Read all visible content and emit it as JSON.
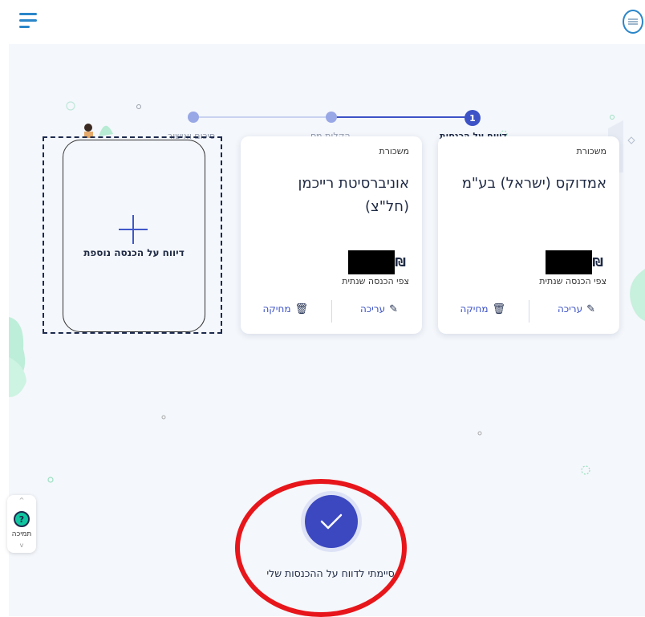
{
  "header": {
    "menu_icon": "hamburger-menu-icon",
    "logo_icon": "organization-logo-icon"
  },
  "stepper": {
    "steps": [
      {
        "label": "דיווח על הכנסות",
        "number": "1",
        "state": "current"
      },
      {
        "label": "הקלות מס",
        "number": "",
        "state": "upcoming"
      },
      {
        "label": "סיכום ואישור",
        "number": "",
        "state": "upcoming"
      }
    ]
  },
  "add_card": {
    "label": "דיווח על הכנסה נוספת",
    "icon": "plus-icon"
  },
  "income_cards": [
    {
      "type": "משכורת",
      "title": "אמדוקס (ישראל) בע\"מ",
      "currency": "₪",
      "amount_redacted": true,
      "amount_subtitle": "צפי הכנסה שנתית",
      "edit_label": "עריכה",
      "delete_label": "מחיקה"
    },
    {
      "type": "משכורת",
      "title": "אוניברסיטת רייכמן (חל\"צ)",
      "currency": "₪",
      "amount_redacted": true,
      "amount_subtitle": "צפי הכנסה שנתית",
      "edit_label": "עריכה",
      "delete_label": "מחיקה"
    }
  ],
  "done": {
    "label": "סיימתי לדווח על ההכנסות שלי",
    "icon": "checkmark-icon"
  },
  "support": {
    "label": "תמיכה",
    "icon": "question-mark-icon"
  },
  "colors": {
    "primary": "#3c52c6",
    "header_icon": "#2b86c9",
    "background": "#f4f7fb",
    "highlight_ring": "#e7161b",
    "support_accent": "#10c6a1"
  }
}
